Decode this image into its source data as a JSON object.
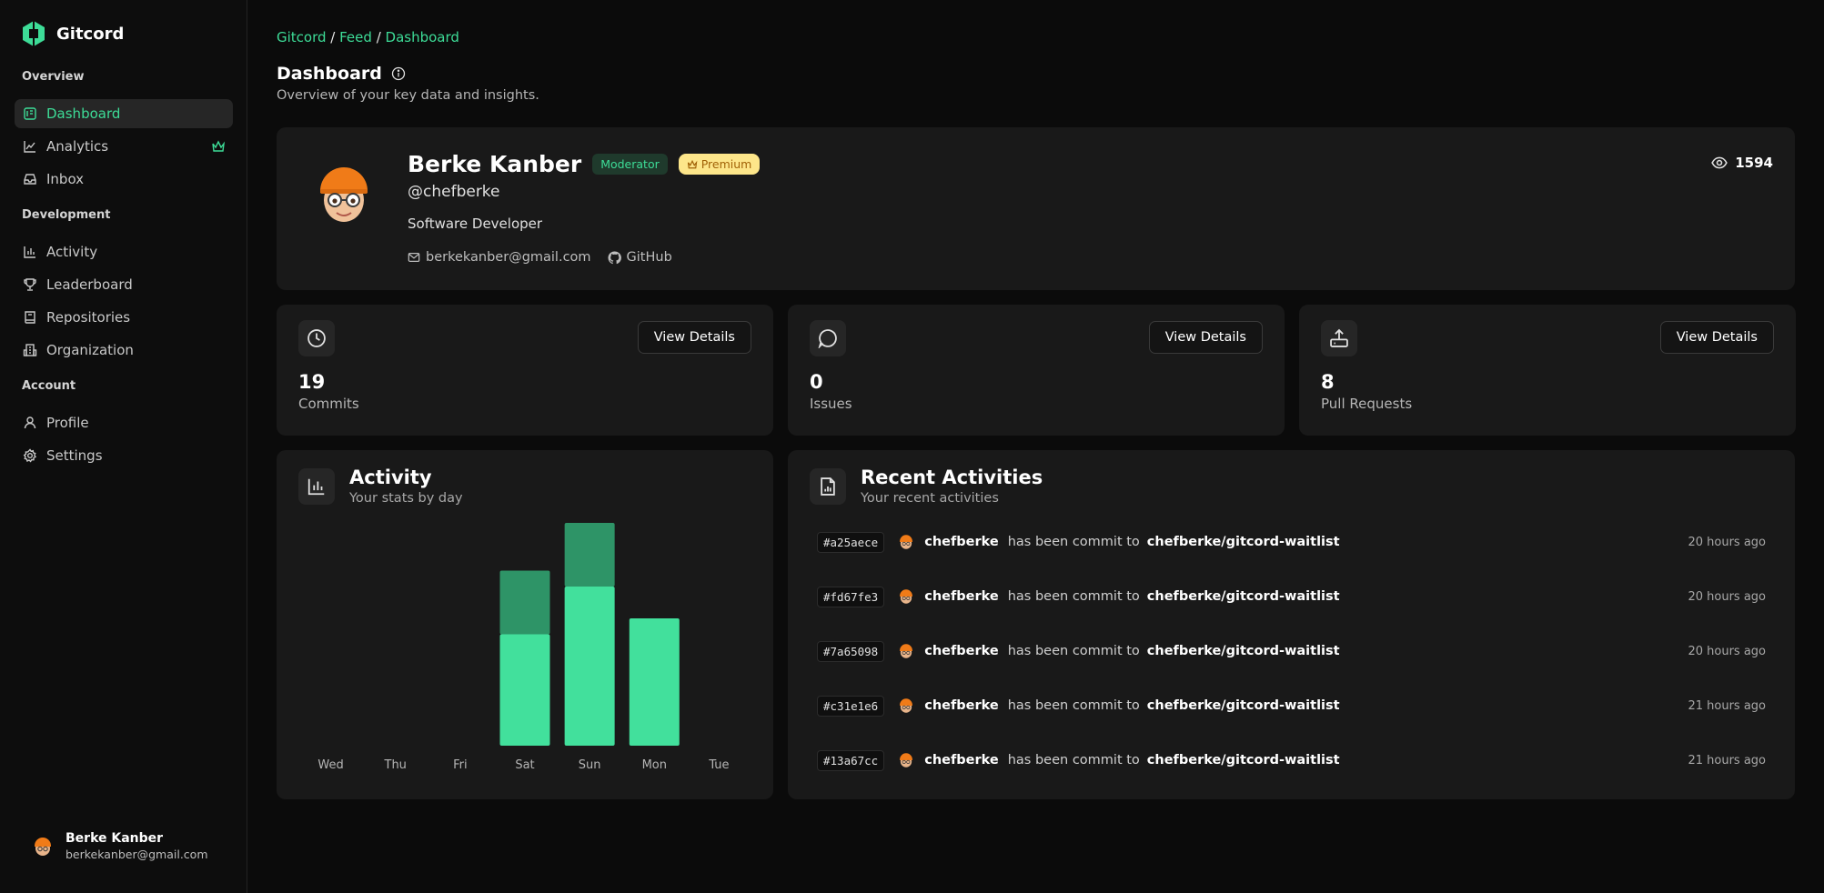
{
  "app": {
    "name": "Gitcord",
    "accent": "#3ddc97"
  },
  "sidebar": {
    "sections": [
      {
        "title": "Overview"
      },
      {
        "title": "Development"
      },
      {
        "title": "Account"
      }
    ],
    "items": [
      {
        "label": "Dashboard",
        "icon": "dashboard-icon",
        "active": true
      },
      {
        "label": "Analytics",
        "icon": "chart-line-icon",
        "badge": "crown-icon"
      },
      {
        "label": "Inbox",
        "icon": "inbox-icon"
      },
      {
        "label": "Activity",
        "icon": "bar-chart-icon"
      },
      {
        "label": "Leaderboard",
        "icon": "trophy-icon"
      },
      {
        "label": "Repositories",
        "icon": "book-icon"
      },
      {
        "label": "Organization",
        "icon": "building-icon"
      },
      {
        "label": "Profile",
        "icon": "user-icon"
      },
      {
        "label": "Settings",
        "icon": "gear-icon"
      }
    ],
    "user": {
      "name": "Berke Kanber",
      "email": "berkekanber@gmail.com"
    }
  },
  "breadcrumb": [
    "Gitcord",
    "Feed",
    "Dashboard"
  ],
  "page": {
    "title": "Dashboard",
    "subtitle": "Overview of your key data and insights."
  },
  "profile": {
    "name": "Berke Kanber",
    "role_badge": "Moderator",
    "premium_badge": "Premium",
    "handle": "@chefberke",
    "title": "Software Developer",
    "email": "berkekanber@gmail.com",
    "github_label": "GitHub",
    "views": "1594"
  },
  "stats": [
    {
      "value": "19",
      "label": "Commits",
      "button": "View Details",
      "icon": "clock-icon"
    },
    {
      "value": "0",
      "label": "Issues",
      "button": "View Details",
      "icon": "message-circle-icon"
    },
    {
      "value": "8",
      "label": "Pull Requests",
      "button": "View Details",
      "icon": "upload-tray-icon"
    }
  ],
  "activity": {
    "title": "Activity",
    "subtitle": "Your stats by day"
  },
  "chart_data": {
    "type": "bar",
    "stacked": true,
    "categories": [
      "Wed",
      "Thu",
      "Fri",
      "Sat",
      "Sun",
      "Mon",
      "Tue"
    ],
    "series": [
      {
        "values": [
          0,
          0,
          0,
          7,
          10,
          8,
          0
        ],
        "color": "#42e09c"
      },
      {
        "values": [
          0,
          0,
          0,
          4,
          4,
          0,
          0
        ],
        "color": "#2e9467"
      }
    ],
    "ylim": [
      0,
      14
    ],
    "grid": false,
    "legend": "none"
  },
  "recent": {
    "title": "Recent Activities",
    "subtitle": "Your recent activities",
    "items": [
      {
        "hash": "#a25aece",
        "user": "chefberke",
        "action": "has been commit to",
        "repo": "chefberke/gitcord-waitlist",
        "time": "20 hours ago"
      },
      {
        "hash": "#fd67fe3",
        "user": "chefberke",
        "action": "has been commit to",
        "repo": "chefberke/gitcord-waitlist",
        "time": "20 hours ago"
      },
      {
        "hash": "#7a65098",
        "user": "chefberke",
        "action": "has been commit to",
        "repo": "chefberke/gitcord-waitlist",
        "time": "20 hours ago"
      },
      {
        "hash": "#c31e1e6",
        "user": "chefberke",
        "action": "has been commit to",
        "repo": "chefberke/gitcord-waitlist",
        "time": "21 hours ago"
      },
      {
        "hash": "#13a67cc",
        "user": "chefberke",
        "action": "has been commit to",
        "repo": "chefberke/gitcord-waitlist",
        "time": "21 hours ago"
      }
    ]
  }
}
